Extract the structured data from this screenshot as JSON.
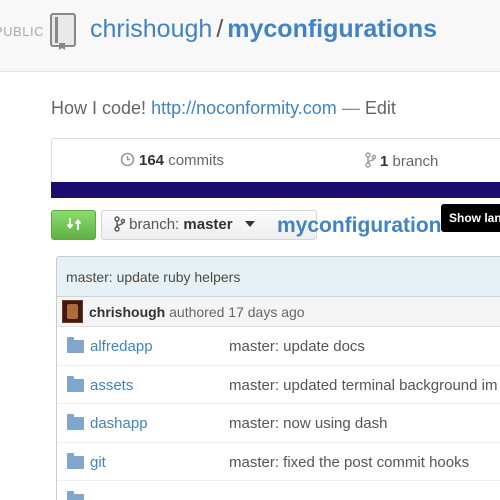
{
  "header": {
    "visibility": "PUBLIC",
    "owner": "chrishough",
    "separator": "/",
    "repo": "myconfigurations",
    "repo_icon": "book-icon"
  },
  "description": {
    "text": "How I code!",
    "link": "http://noconformity.com",
    "dash": "—",
    "edit": "Edit"
  },
  "stats": {
    "commits_count": "164",
    "commits_label": "commits",
    "branches_count": "1",
    "branches_label": "branch",
    "language_bar_color": "#1e0c6e"
  },
  "toolbar": {
    "compare_icon": "compare-arrows-icon",
    "branch_prefix": "branch:",
    "branch_name": "master",
    "path": "myconfigurations",
    "path_sep": "/",
    "new_file": "+",
    "tooltip": "Show lang"
  },
  "commit": {
    "message": "master: update ruby helpers",
    "author": "chrishough",
    "authored": "authored 17 days ago"
  },
  "files": [
    {
      "name": "alfredapp",
      "message": "master: update docs"
    },
    {
      "name": "assets",
      "message": "master: updated terminal background im"
    },
    {
      "name": "dashapp",
      "message": "master: now using dash"
    },
    {
      "name": "git",
      "message": "master: fixed the post commit hooks"
    },
    {
      "name": "",
      "message": ""
    }
  ],
  "colors": {
    "link": "#4183c4",
    "compare_button": "#60b044"
  }
}
